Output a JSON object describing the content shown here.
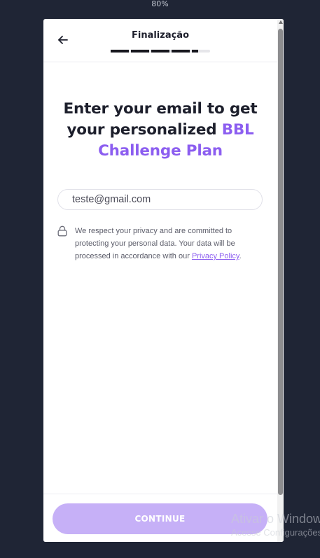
{
  "browser": {
    "zoom_label": "80%"
  },
  "header": {
    "title": "Finalização",
    "back_icon": "arrow-left-icon",
    "progress": {
      "completed_steps": 4.5,
      "total_steps": 5
    }
  },
  "main": {
    "headline_part1": "Enter your email to get your personalized ",
    "headline_accent": "BBL Challenge Plan",
    "email": {
      "value": "teste@gmail.com",
      "placeholder": ""
    },
    "privacy": {
      "icon": "lock-icon",
      "text": "We respect your privacy and are committed to protecting your personal data. Your data will be processed in accordance with our ",
      "link_label": "Privacy Policy",
      "suffix": "."
    }
  },
  "footer": {
    "continue_label": "CONTINUE"
  },
  "os_watermark": {
    "title": "Ativar o Windows",
    "subtitle": "Acesse Configurações para ativar o Windows."
  },
  "colors": {
    "accent": "#8c5ef0",
    "button_disabled": "#c6b0f7",
    "background": "#1f2535",
    "text_dark": "#1d1f2c"
  }
}
